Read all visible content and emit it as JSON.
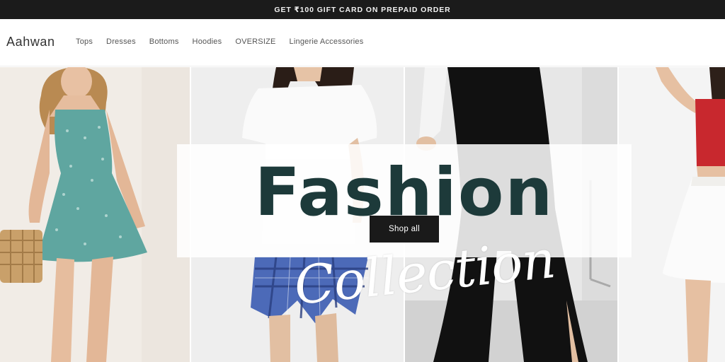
{
  "announcement": {
    "text": "GET ₹100 GIFT CARD ON PREPAID ORDER"
  },
  "header": {
    "logo": "Aahwan",
    "nav": [
      "Tops",
      "Dresses",
      "Bottoms",
      "Hoodies",
      "OVERSIZE",
      "Lingerie Accessories"
    ]
  },
  "hero": {
    "title": "Fashion",
    "script": "Collection",
    "button_label": "Shop all",
    "colors": {
      "title": "#1d3a3a",
      "button": "#1a1a1a",
      "dress": "#5fa6a0",
      "top": "#c8282e",
      "pants": "#111111"
    }
  }
}
